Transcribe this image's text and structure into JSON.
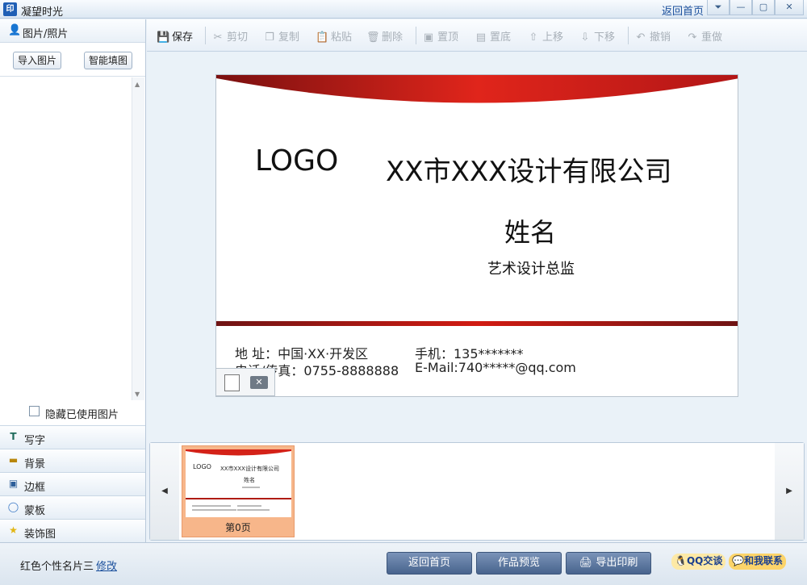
{
  "app": {
    "title": "凝望时光",
    "icon_text": "印",
    "home_link": "返回首页"
  },
  "window_controls": [
    "⏷",
    "—",
    "▢",
    "✕"
  ],
  "sidebar": {
    "header_label": "图片/照片",
    "import_button": "导入图片",
    "smart_fill_button": "智能填图",
    "hide_used_label": "隐藏已使用图片",
    "categories": [
      {
        "label": "写字",
        "icon": "T"
      },
      {
        "label": "背景",
        "icon": "▬"
      },
      {
        "label": "边框",
        "icon": "▣"
      },
      {
        "label": "蒙板",
        "icon": "◯"
      },
      {
        "label": "装饰图",
        "icon": "★"
      }
    ]
  },
  "toolbar": {
    "save": "保存",
    "cut": "剪切",
    "copy": "复制",
    "paste": "粘贴",
    "delete": "删除",
    "bring_top": "置顶",
    "send_bottom": "置底",
    "move_up": "上移",
    "move_down": "下移",
    "undo": "撤销",
    "redo": "重做"
  },
  "card": {
    "logo": "LOGO",
    "company": "XX市XXX设计有限公司",
    "name": "姓名",
    "job_title": "艺术设计总监",
    "address": "地  址：中国·XX·开发区",
    "mobile": "手机：135*******",
    "phone": "电话/传真：0755-8888888",
    "email": "E-Mail:740*****@qq.com"
  },
  "thumbnails": [
    {
      "label": "第0页"
    }
  ],
  "bottom": {
    "template_name": "红色个性名片三",
    "edit_link": "修改",
    "home_button": "返回首页",
    "preview_button": "作品预览",
    "print_button": "导出印刷",
    "qq_chat": "QQ交谈",
    "contact_me": "和我联系"
  }
}
